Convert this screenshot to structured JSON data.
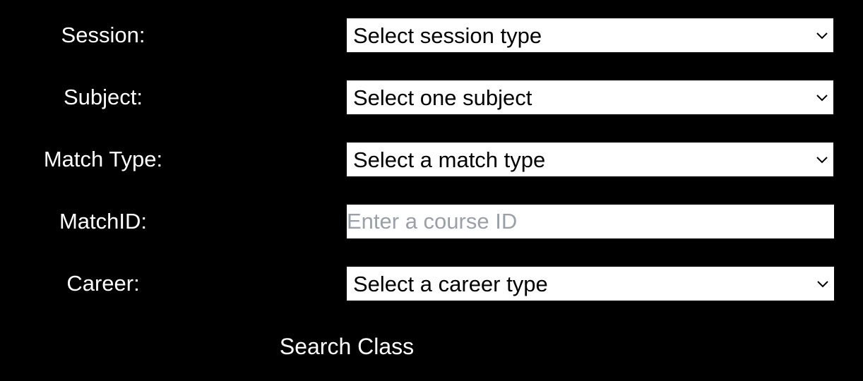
{
  "form": {
    "session": {
      "label": "Session:",
      "selected": "Select session type",
      "icon": "chevron-down-icon"
    },
    "subject": {
      "label": "Subject:",
      "selected": "Select one subject",
      "icon": "chevron-down-icon"
    },
    "match_type": {
      "label": "Match Type:",
      "selected": "Select a match type",
      "icon": "chevron-down-icon"
    },
    "match_id": {
      "label": "MatchID:",
      "value": "",
      "placeholder": "Enter a course ID"
    },
    "career": {
      "label": "Career:",
      "selected": "Select a career type",
      "icon": "chevron-down-icon"
    },
    "search_label": "Search Class"
  },
  "colors": {
    "background": "#000000",
    "label_text": "#ffffff",
    "field_background": "#ffffff",
    "field_text": "#000000",
    "placeholder_text": "#9aa0a9"
  }
}
